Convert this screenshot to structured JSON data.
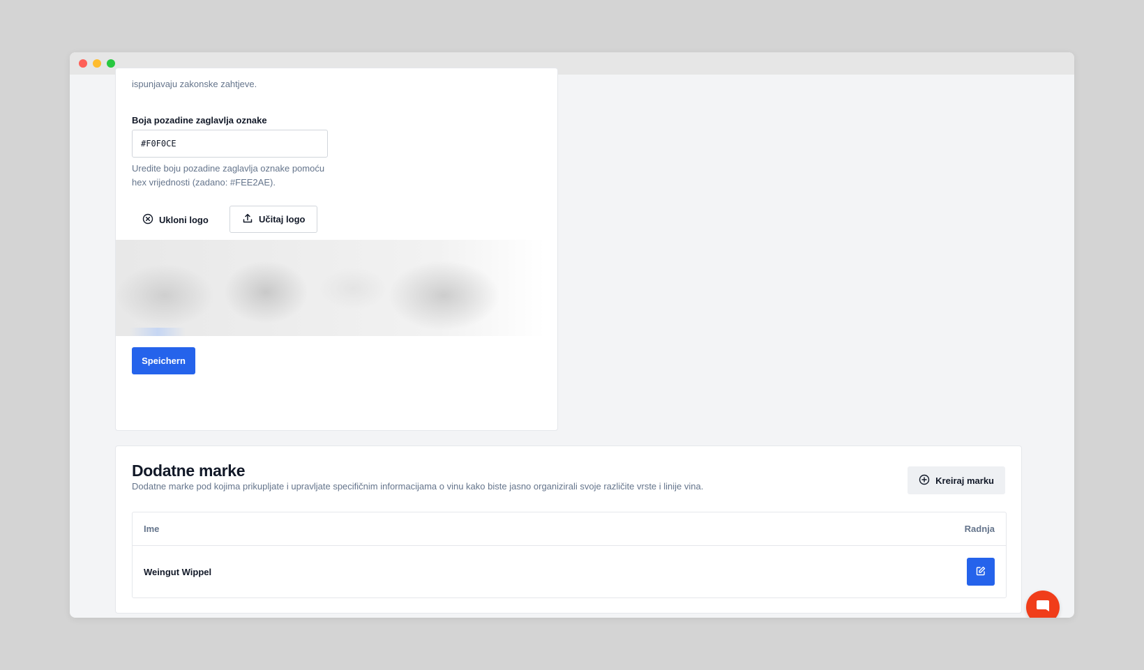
{
  "branding_form": {
    "help_text_top": "ispunjavaju zakonske zahtjeve.",
    "header_color_label": "Boja pozadine zaglavlja oznake",
    "header_color_value": "#F0F0CE",
    "header_color_help": "Uredite boju pozadine zaglavlja oznake pomoću hex vrijednosti (zadano: #FEE2AE).",
    "remove_logo_label": "Ukloni logo",
    "upload_logo_label": "Učitaj logo",
    "save_label": "Speichern"
  },
  "brands": {
    "title": "Dodatne marke",
    "description": "Dodatne marke pod kojima prikupljate i upravljate specifičnim informacijama o vinu kako biste jasno organizirali svoje različite vrste i linije vina.",
    "create_label": "Kreiraj marku",
    "columns": {
      "name": "Ime",
      "action": "Radnja"
    },
    "rows": [
      {
        "name": "Weingut Wippel"
      }
    ]
  },
  "icons": {
    "remove": "circle-x-icon",
    "upload": "upload-icon",
    "create": "circle-plus-icon",
    "edit": "edit-icon",
    "chat": "chat-icon"
  },
  "colors": {
    "primary": "#2563eb",
    "chat": "#f03d1a"
  }
}
